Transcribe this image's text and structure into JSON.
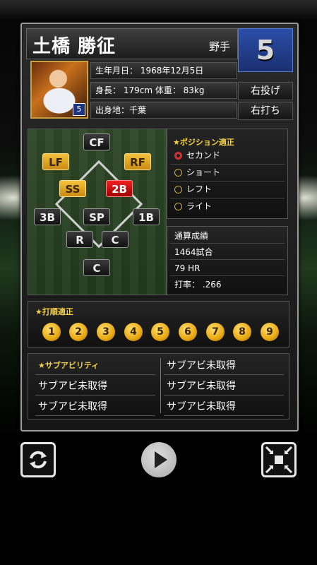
{
  "player": {
    "name": "土橋 勝征",
    "type": "野手",
    "number": "5",
    "throws": "右投げ",
    "bats": "右打ち",
    "birth": "生年月日： 1968年12月5日",
    "body": "身長： 179cm 体重： 83kg",
    "hometown": "出身地：千葉",
    "photo_badge": "5"
  },
  "field": {
    "positions": [
      {
        "id": "cf",
        "label": "CF",
        "state": "normal"
      },
      {
        "id": "lf",
        "label": "LF",
        "state": "gold"
      },
      {
        "id": "rf",
        "label": "RF",
        "state": "gold"
      },
      {
        "id": "ss",
        "label": "SS",
        "state": "gold"
      },
      {
        "id": "2b",
        "label": "2B",
        "state": "red"
      },
      {
        "id": "3b",
        "label": "3B",
        "state": "normal"
      },
      {
        "id": "sp",
        "label": "SP",
        "state": "normal"
      },
      {
        "id": "1b",
        "label": "1B",
        "state": "normal"
      },
      {
        "id": "r",
        "label": "R",
        "state": "normal"
      },
      {
        "id": "c-pitch",
        "label": "C",
        "state": "normal"
      },
      {
        "id": "c",
        "label": "C",
        "state": "normal"
      }
    ]
  },
  "position_fit": {
    "title": "★ポジション適正",
    "items": [
      "セカンド",
      "ショート",
      "レフト",
      "ライト"
    ],
    "selected_index": 0
  },
  "career": {
    "title": "通算成績",
    "games": "1464試合",
    "hr": "79 HR",
    "avg": "打率： .266"
  },
  "batting_order": {
    "title": "★打順適正",
    "numbers": [
      "1",
      "2",
      "3",
      "4",
      "5",
      "6",
      "7",
      "8",
      "9"
    ]
  },
  "sub_abilities": {
    "title": "★サブアビリティ",
    "cells": [
      "サブアビ未取得",
      "サブアビ未取得",
      "サブアビ未取得",
      "サブアビ未取得",
      "サブアビ未取得"
    ]
  },
  "controls": {
    "refresh_icon": "refresh-icon",
    "play_icon": "play-icon",
    "shrink_icon": "shrink-icon"
  },
  "colors": {
    "accent_gold": "#f5c23a",
    "accent_red": "#e01010",
    "number_blue": "#2b4ea8"
  }
}
